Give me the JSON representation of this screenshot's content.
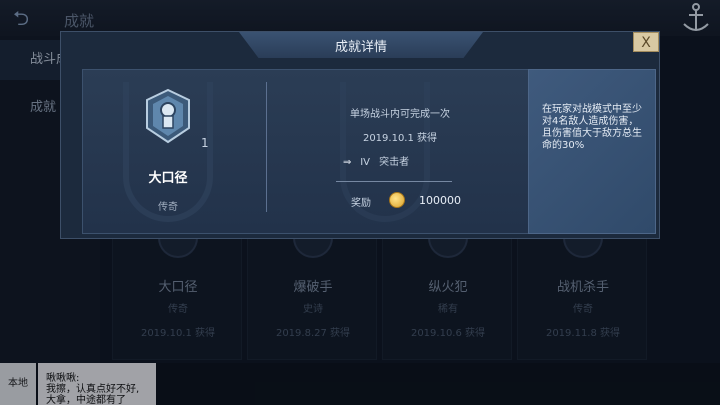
{
  "header": {
    "title": "成就",
    "back_icon": "back-arrow-icon",
    "corner_icon": "anchor-icon"
  },
  "sidebar": {
    "items": [
      {
        "label": "战斗成就"
      },
      {
        "label": "成就"
      }
    ]
  },
  "cards": [
    {
      "name": "大口径",
      "rank": "传奇",
      "date": "2019.10.1 获得"
    },
    {
      "name": "爆破手",
      "rank": "史诗",
      "date": "2019.8.27 获得"
    },
    {
      "name": "纵火犯",
      "rank": "稀有",
      "date": "2019.10.6 获得"
    },
    {
      "name": "战机杀手",
      "rank": "传奇",
      "date": "2019.11.8 获得"
    }
  ],
  "chat": {
    "channel": "本地",
    "sender": "啾啾啾:",
    "line1": "我擦，认真点好不好,",
    "line2": "大拿，中途都有了"
  },
  "modal": {
    "title": "成就详情",
    "close_label": "X",
    "badge_count": "1",
    "name": "大口径",
    "rank": "传奇",
    "condition": "单场战斗内可完成一次",
    "date": "2019.10.1 获得",
    "tier_level": "IV",
    "tier_name": "突击者",
    "reward_label": "奖励",
    "reward_value": "100000",
    "description": "在玩家对战模式中至少对4名敌人造成伤害，且伤害值大于敌方总生命的30%"
  },
  "colors": {
    "accent": "#3a5272",
    "close": "#d9c9a3",
    "coin": "#e0ac33"
  }
}
